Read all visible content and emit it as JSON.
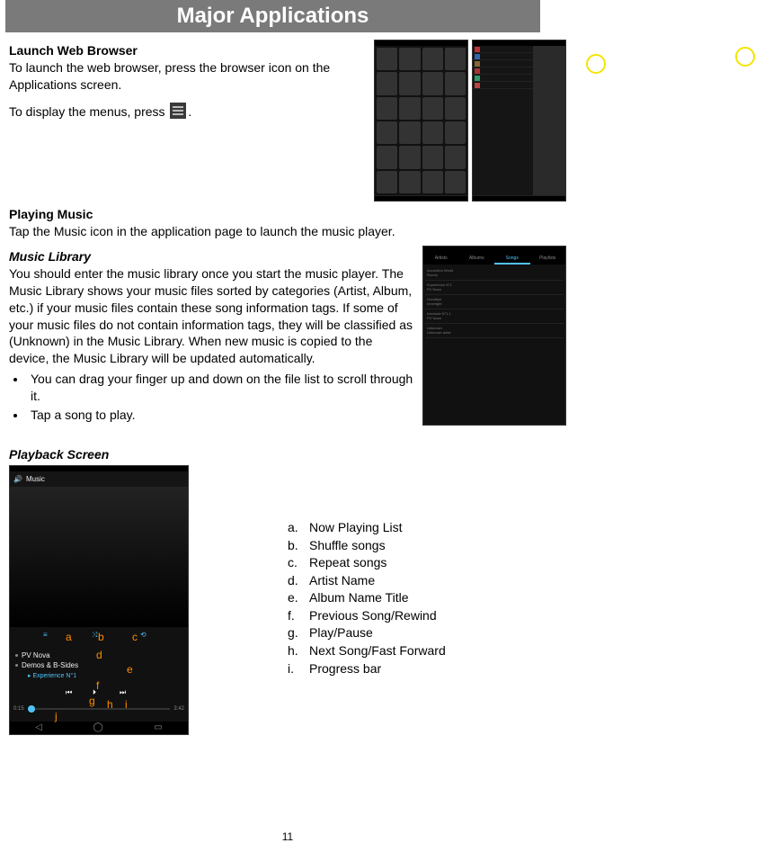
{
  "header": {
    "title": "Major Applications"
  },
  "sections": {
    "browser": {
      "title": "Launch Web Browser",
      "p1": "To launch the web browser, press the browser icon on the Applications screen.",
      "p2a": "To display the menus, press ",
      "p2b": "."
    },
    "music": {
      "title": "Playing Music",
      "p1": "Tap the Music icon in the application page to launch the music player."
    },
    "library": {
      "title": "Music Library",
      "p1": "You should enter the music library once you start the music player. The Music Library shows your music files sorted by categories (Artist, Album, etc.) if your music files contain these song information tags. If some of your music files do not contain information tags, they will be classified as (Unknown) in the Music Library. When new music is copied to the device, the Music Library will be updated automatically.",
      "bullets": [
        "You can drag your finger up and down on the file list to scroll through it.",
        "Tap a song to play."
      ],
      "tabs": [
        "Artists",
        "Albums",
        "Songs",
        "Playlists"
      ],
      "items": [
        {
          "t": "Accordion World",
          "s": "Rondo"
        },
        {
          "t": "Experience N°1",
          "s": "PV Nova"
        },
        {
          "t": "Goodbye",
          "s": "Innerlight"
        },
        {
          "t": "Interlude N°1.1",
          "s": "PV Nova"
        },
        {
          "t": "Unknown",
          "s": "Unknown artist"
        }
      ]
    },
    "playback": {
      "title": "Playback Screen",
      "top_label": "Music",
      "artist": "PV Nova",
      "album": "Demos & B-Sides",
      "track": "Experience N°1",
      "time_cur": "0:15",
      "time_total": "3:42",
      "legend": [
        {
          "l": "a.",
          "d": "Now Playing List"
        },
        {
          "l": "b.",
          "d": "Shuffle songs"
        },
        {
          "l": "c.",
          "d": "Repeat songs"
        },
        {
          "l": "d.",
          "d": "Artist Name"
        },
        {
          "l": "e.",
          "d": "Album Name Title"
        },
        {
          "l": "f.",
          "d": "Previous Song/Rewind"
        },
        {
          "l": "g.",
          "d": "Play/Pause"
        },
        {
          "l": "h.",
          "d": "Next Song/Fast Forward"
        },
        {
          "l": "i.",
          "d": "Progress bar"
        }
      ],
      "annot": {
        "a": "a",
        "b": "b",
        "c": "c",
        "d": "d",
        "e": "e",
        "f": "f",
        "g": "g",
        "h": "h",
        "i": "i",
        "j": "j"
      }
    }
  },
  "page_number": "11"
}
